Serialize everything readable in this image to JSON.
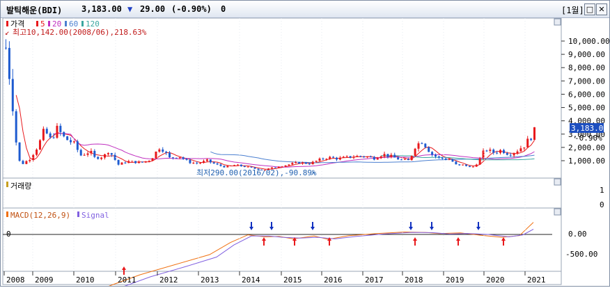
{
  "header": {
    "name": "발틱해운(BDI)",
    "price": "3,183.00",
    "change_arrow": "▼",
    "change": "29.00",
    "change_pct": "(-0.90%)",
    "volume": "0",
    "period": "[1월]"
  },
  "price_panel": {
    "legend_price": "가격",
    "legend_ma": [
      "5",
      "20",
      "60",
      "120"
    ],
    "max_note": "최고10,142.00(2008/06),218.63%",
    "min_note": "최저290.00(2016/02),-90.89%",
    "y_ticks": [
      "10,000.00",
      "9,000.00",
      "8,000.00",
      "7,000.00",
      "6,000.00",
      "5,000.00",
      "4,000.00",
      "3,000.00",
      "2,000.00",
      "1,000.00"
    ],
    "last_price_tag": "3,183.00",
    "last_pct_tag": "-0.90%"
  },
  "volume_panel": {
    "legend": "거래량",
    "y_ticks": [
      "1",
      "0"
    ]
  },
  "macd_panel": {
    "legend_macd": "MACD(12,26,9)",
    "legend_signal": "Signal",
    "y_ticks": [
      "0.00",
      "-500.00"
    ],
    "zero_label": "0"
  },
  "x_axis": {
    "labels": [
      "2008",
      "2009",
      "2010",
      "2011",
      "2012",
      "2013",
      "2014",
      "2015",
      "2016",
      "2017",
      "2018",
      "2019",
      "2020",
      "2021"
    ]
  },
  "colors": {
    "up": "#e8191c",
    "down": "#1e5bd0",
    "ma5": "#e8191c",
    "ma20": "#c030c0",
    "ma60": "#4a7fd0",
    "ma120": "#3aa6a0",
    "macd": "#f07010",
    "signal": "#8060e0",
    "buy": "#e8191c",
    "sell": "#1030c0"
  },
  "chart_data": {
    "type": "line",
    "title": "발틱해운(BDI)",
    "ylim": [
      0,
      10500
    ],
    "x": [
      "2008",
      "2009",
      "2010",
      "2011",
      "2012",
      "2013",
      "2014",
      "2015",
      "2016",
      "2017",
      "2018",
      "2019",
      "2020",
      "2021"
    ],
    "series": [
      {
        "name": "가격",
        "values": [
          9500,
          1800,
          3200,
          1700,
          800,
          1200,
          1400,
          700,
          300,
          900,
          1300,
          1400,
          900,
          3183
        ]
      },
      {
        "name": "MACD(12,26,9)",
        "values": [
          -1500,
          -1200,
          -850,
          -600,
          -350,
          -150,
          -10,
          -60,
          -90,
          40,
          60,
          -20,
          -60,
          300
        ]
      },
      {
        "name": "Signal",
        "values": [
          -1400,
          -1250,
          -900,
          -650,
          -400,
          -200,
          -40,
          -50,
          -100,
          20,
          50,
          0,
          -50,
          150
        ]
      }
    ]
  }
}
